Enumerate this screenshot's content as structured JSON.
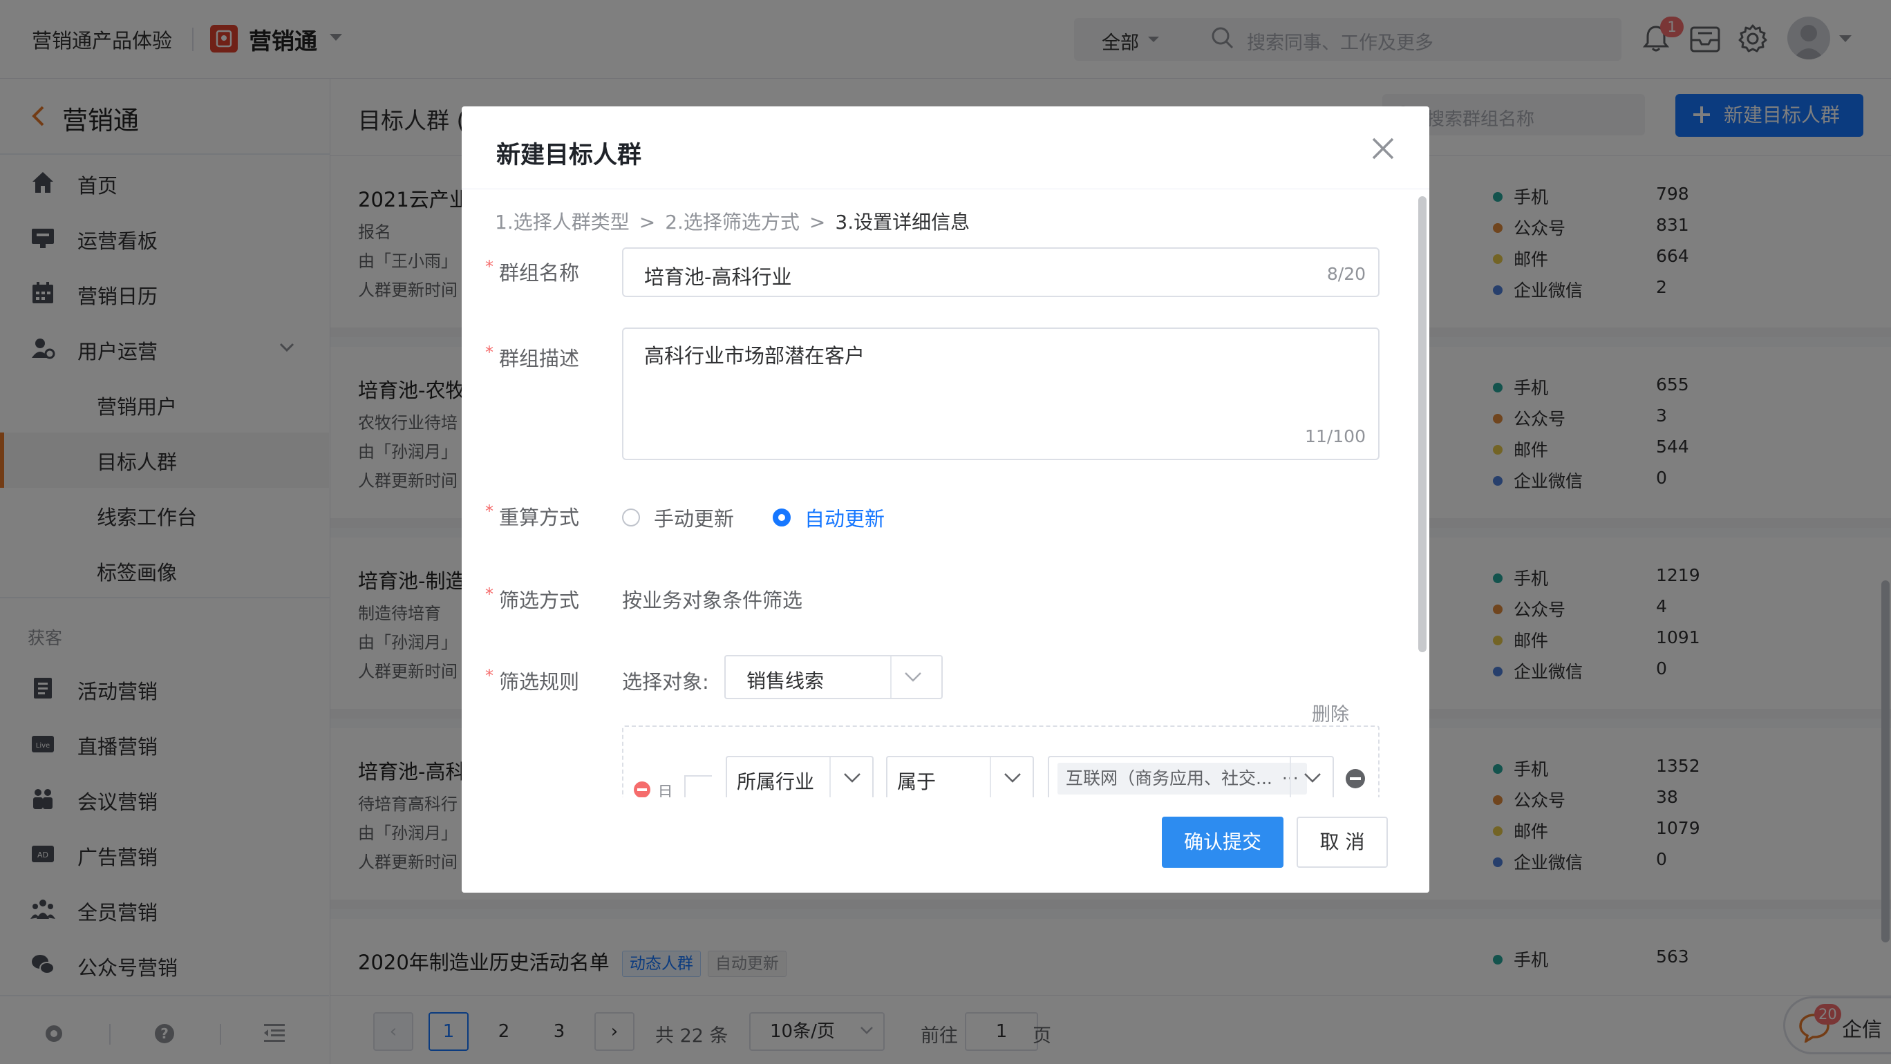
{
  "topbar": {
    "tenant_name": "营销通产品体验",
    "app_name": "营销通",
    "search_scope": "全部",
    "search_placeholder": "搜索同事、工作及更多",
    "notification_count": "1"
  },
  "sidebar": {
    "title": "营销通",
    "items": [
      {
        "label": "首页",
        "icon": "home-icon"
      },
      {
        "label": "运营看板",
        "icon": "dashboard-icon"
      },
      {
        "label": "营销日历",
        "icon": "calendar-icon"
      },
      {
        "label": "用户运营",
        "icon": "user-ops-icon"
      }
    ],
    "sub_items": [
      {
        "label": "营销用户"
      },
      {
        "label": "目标人群",
        "active": true
      },
      {
        "label": "线索工作台"
      },
      {
        "label": "标签画像"
      }
    ],
    "section_label": "获客",
    "acq_items": [
      {
        "label": "活动营销",
        "icon": "activity-icon"
      },
      {
        "label": "直播营销",
        "icon": "live-icon"
      },
      {
        "label": "会议营销",
        "icon": "meeting-icon"
      },
      {
        "label": "广告营销",
        "icon": "ad-icon"
      },
      {
        "label": "全员营销",
        "icon": "staff-icon"
      },
      {
        "label": "公众号营销",
        "icon": "wechat-icon"
      }
    ]
  },
  "main": {
    "header_title": "目标人群 (",
    "group_search_placeholder": "搜索群组名称",
    "new_button": "新建目标人群",
    "cards": [
      {
        "title": "2021云产业",
        "desc": "报名",
        "by": "由「王小雨」",
        "update": "人群更新时间",
        "stats": [
          {
            "label": "手机",
            "value": "798"
          },
          {
            "label": "公众号",
            "value": "831"
          },
          {
            "label": "邮件",
            "value": "664"
          },
          {
            "label": "企业微信",
            "value": "2"
          }
        ]
      },
      {
        "title": "培育池-农牧",
        "desc": "农牧行业待培",
        "by": "由「孙润月」",
        "update": "人群更新时间",
        "stats": [
          {
            "label": "手机",
            "value": "655"
          },
          {
            "label": "公众号",
            "value": "3"
          },
          {
            "label": "邮件",
            "value": "544"
          },
          {
            "label": "企业微信",
            "value": "0"
          }
        ]
      },
      {
        "title": "培育池-制造",
        "desc": "制造待培育",
        "by": "由「孙润月」",
        "update": "人群更新时间",
        "stats": [
          {
            "label": "手机",
            "value": "1219"
          },
          {
            "label": "公众号",
            "value": "4"
          },
          {
            "label": "邮件",
            "value": "1091"
          },
          {
            "label": "企业微信",
            "value": "0"
          }
        ]
      },
      {
        "title": "培育池-高科",
        "desc": "待培育高科行",
        "by": "由「孙润月」",
        "update": "人群更新时间",
        "stats": [
          {
            "label": "手机",
            "value": "1352"
          },
          {
            "label": "公众号",
            "value": "38"
          },
          {
            "label": "邮件",
            "value": "1079"
          },
          {
            "label": "企业微信",
            "value": "0"
          }
        ]
      },
      {
        "title": "2020年制造业历史活动名单",
        "tag1": "动态人群",
        "tag2": "自动更新",
        "stats": [
          {
            "label": "手机",
            "value": "563"
          }
        ]
      }
    ],
    "stat_colors": [
      "#26a69a",
      "#e08a3c",
      "#e6c84b",
      "#4f7fd9"
    ],
    "pager": {
      "pages": [
        "1",
        "2",
        "3"
      ],
      "total": "共 22 条",
      "page_size": "10条/页",
      "goto_label": "前往",
      "goto_value": "1",
      "page_unit": "页"
    }
  },
  "modal": {
    "title": "新建目标人群",
    "steps": [
      "1.选择人群类型",
      "2.选择筛选方式",
      "3.设置详细信息"
    ],
    "step_sep": ">",
    "required_mark": "*",
    "fields": {
      "name_label": "群组名称",
      "name_value": "培育池-高科行业",
      "name_count": "8/20",
      "desc_label": "群组描述",
      "desc_value": "高科行业市场部潜在客户",
      "desc_count": "11/100",
      "recalc_label": "重算方式",
      "recalc_manual": "手动更新",
      "recalc_auto": "自动更新",
      "filter_label": "筛选方式",
      "filter_value": "按业务对象条件筛选",
      "rule_label": "筛选规则",
      "object_label": "选择对象:",
      "object_value": "销售线索",
      "delete_label": "删除",
      "cond_field": "所属行业",
      "cond_op": "属于",
      "cond_value": "互联网（商务应用、社交...",
      "cond_more": "···",
      "and_label": "且"
    },
    "confirm_button": "确认提交",
    "cancel_button": "取 消"
  },
  "qixin": {
    "label": "企信",
    "badge": "20"
  },
  "colors": {
    "primary": "#1677ff",
    "accent": "#e6782b",
    "danger": "#f56c6c"
  }
}
